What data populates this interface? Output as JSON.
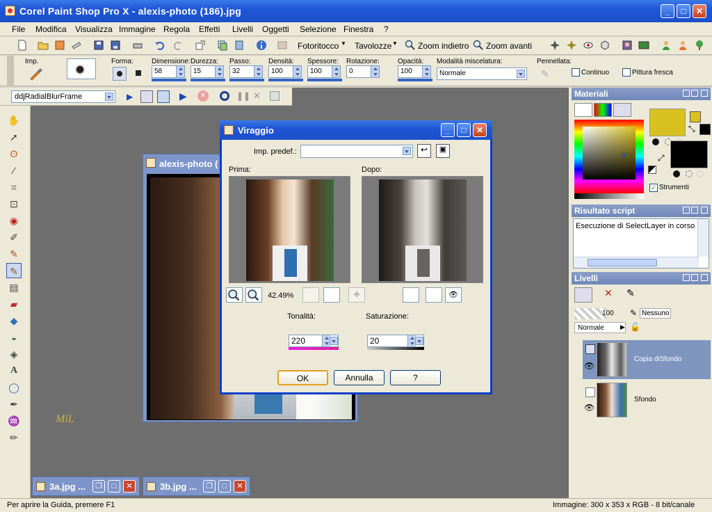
{
  "window": {
    "title": "Corel Paint Shop Pro X - alexis-photo (186).jpg"
  },
  "menu": [
    "File",
    "Modifica",
    "Visualizza",
    "Immagine",
    "Regola",
    "Effetti",
    "Livelli",
    "Oggetti",
    "Selezione",
    "Finestra",
    "?"
  ],
  "toolbar": {
    "fotoritocco": "Fotoritocco",
    "tavolozze": "Tavolozze",
    "zoom_indietro": "Zoom indietro",
    "zoom_avanti": "Zoom avanti"
  },
  "tool_options": {
    "imp_label": "Imp.",
    "forma_label": "Forma:",
    "dimensione_label": "Dimensione:",
    "dimensione": "58",
    "durezza_label": "Durezza:",
    "durezza": "15",
    "passo_label": "Passo:",
    "passo": "32",
    "densita_label": "Densità:",
    "densita": "100",
    "spessore_label": "Spessore:",
    "spessore": "100",
    "rotazione_label": "Rotazione:",
    "rotazione": "0",
    "opacita_label": "Opacità:",
    "opacita": "100",
    "modalita_label": "Modalità miscelatura:",
    "modalita": "Normale",
    "pennellata_label": "Pennellata:",
    "continuo": "Continuo",
    "pittura_fresca": "Pittura fresca"
  },
  "script_bar": {
    "script": "ddjRadialBlurFrame"
  },
  "image_window": {
    "title": "alexis-photo (",
    "signature": "MiL"
  },
  "minimized": [
    {
      "title": "3a.jpg ..."
    },
    {
      "title": "3b.jpg ..."
    }
  ],
  "dialog": {
    "title": "Viraggio",
    "preset_label": "Imp. predef.:",
    "preset_value": "",
    "prima_label": "Prima:",
    "dopo_label": "Dopo:",
    "zoom": "42.49%",
    "tonalita_label": "Tonalità:",
    "tonalita": "220",
    "saturazione_label": "Saturazione:",
    "saturazione": "20",
    "ok": "OK",
    "annulla": "Annulla",
    "help": "?"
  },
  "panels": {
    "materiali": "Materiali",
    "strumenti": "Strumenti",
    "risultato_script": "Risultato script",
    "script_output": "Esecuzione di SelectLayer in corso",
    "livelli": "Livelli",
    "opacity": "100",
    "nessuno": "Nessuno",
    "blend": "Normale",
    "layers": [
      {
        "name": "Copia diSfondo"
      },
      {
        "name": "Sfondo"
      }
    ]
  },
  "status": {
    "help": "Per aprire la Guida, premere F1",
    "info": "Immagine:  300 x 353 x RGB - 8 bit/canale"
  },
  "colors": {
    "foreground": "#d8c020",
    "background": "#000000",
    "titlebar": "#1f56d6",
    "panel_header": "#7a8fbf",
    "selected_layer": "#7d95bf"
  }
}
